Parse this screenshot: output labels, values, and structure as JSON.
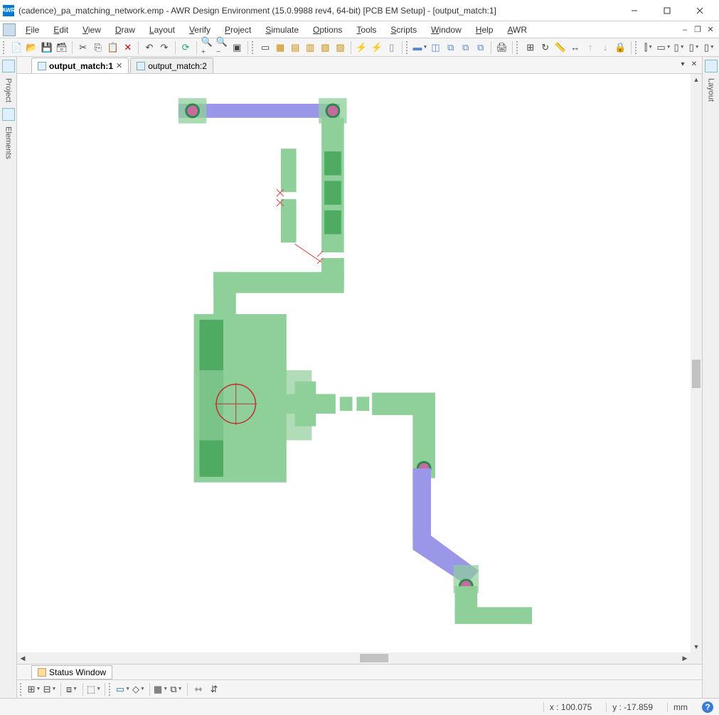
{
  "app": {
    "icon_text": "AWR"
  },
  "title": "(cadence)_pa_matching_network.emp - AWR Design Environment (15.0.9988 rev4, 64-bit) [PCB EM Setup] - [output_match:1]",
  "menu": {
    "items": [
      "File",
      "Edit",
      "View",
      "Draw",
      "Layout",
      "Verify",
      "Project",
      "Simulate",
      "Options",
      "Tools",
      "Scripts",
      "Window",
      "Help",
      "AWR"
    ]
  },
  "side": {
    "left_labels": [
      "Project",
      "Elements"
    ],
    "right_labels": [
      "Layout"
    ]
  },
  "tabs": {
    "t0": {
      "label": "output_match:1"
    },
    "t1": {
      "label": "output_match:2"
    }
  },
  "status_tab": {
    "label": "Status Window"
  },
  "statusbar": {
    "x_label": "x :",
    "x_val": "100.075",
    "y_label": "y :",
    "y_val": "-17.859",
    "unit": "mm",
    "help": "?"
  },
  "colors": {
    "copper": "#8fcf9a",
    "copper_dark": "#4faa62",
    "pad": "#7fbf8f",
    "route_purple": "#9a97e8",
    "port_pink": "#c66aa0",
    "port_ring": "#2a8a4a",
    "wire": "#d94848"
  }
}
